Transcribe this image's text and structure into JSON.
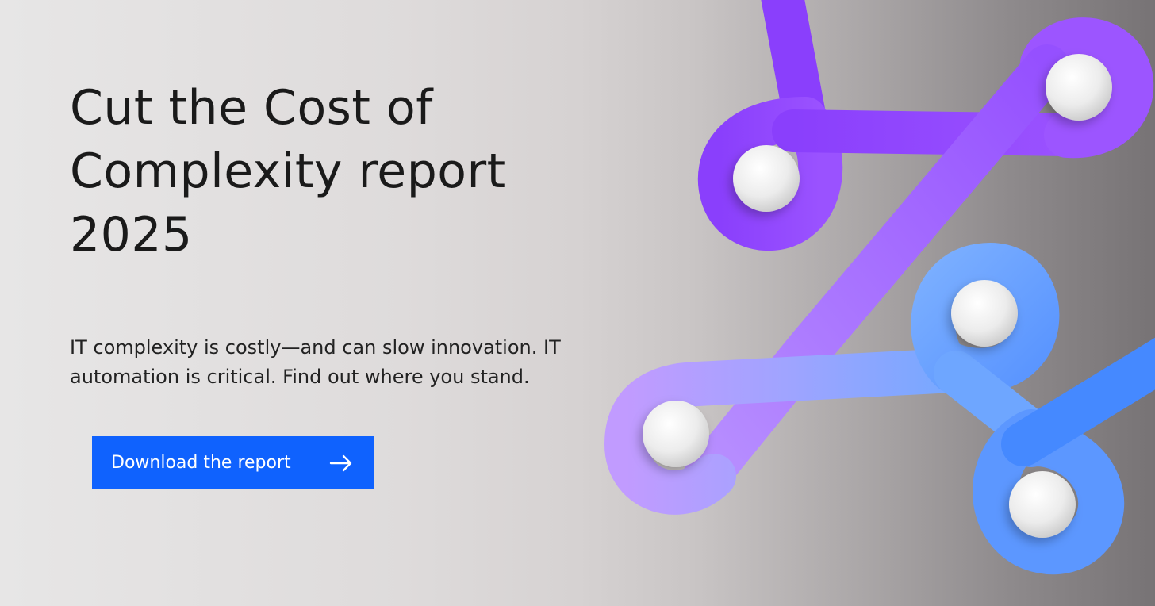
{
  "hero": {
    "headline": "Cut the Cost of\nComplexity report\n2025",
    "subtext": "IT complexity is costly—and can slow innovation. IT\nautomation is critical. Find out where you stand.",
    "cta_label": "Download the report",
    "cta_icon": "arrow-right-icon"
  },
  "colors": {
    "cta_background": "#0f62fe",
    "headline_text": "#1a1a1a",
    "ribbon_purple": "#8a3ffc",
    "ribbon_violet": "#a56eff",
    "ribbon_blue": "#6ea6ff",
    "ribbon_deep_blue": "#4589ff"
  }
}
